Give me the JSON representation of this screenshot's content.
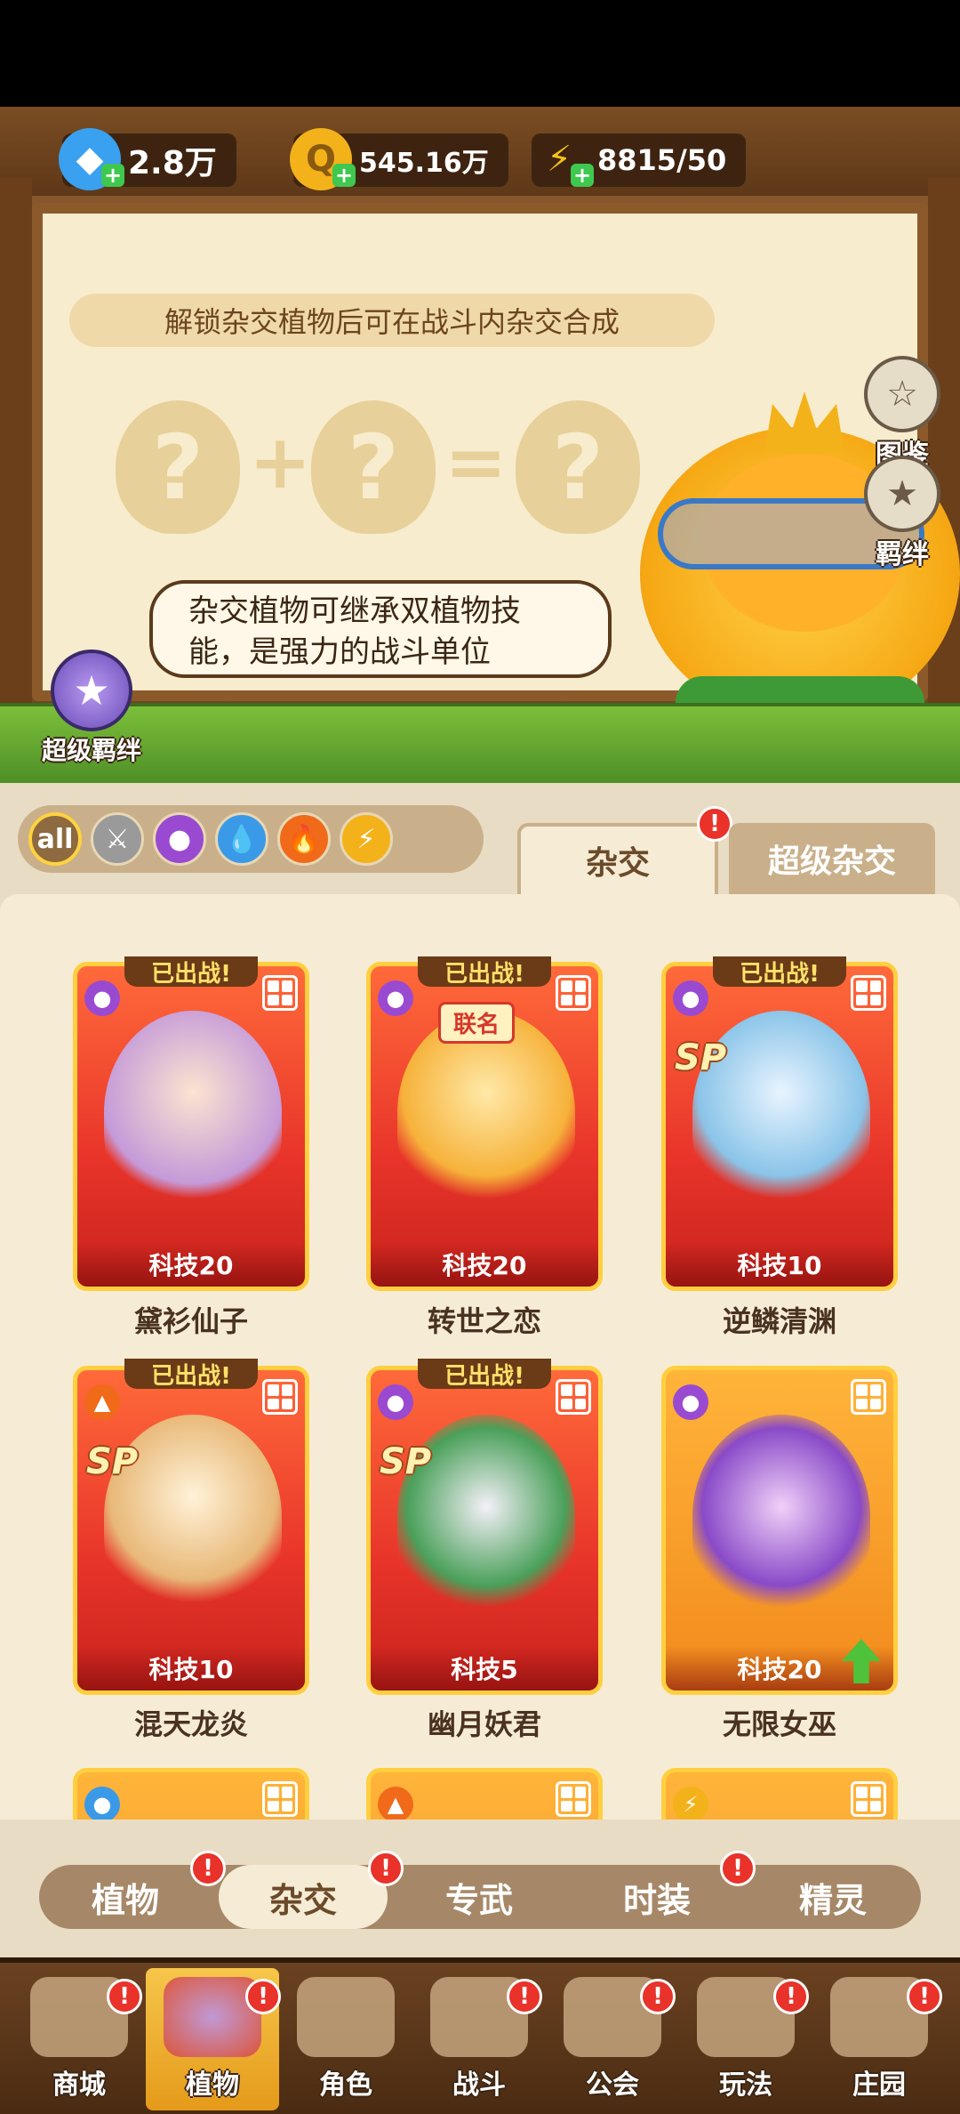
{
  "resources": [
    {
      "icon": "diamond-icon",
      "value": "2.8万"
    },
    {
      "icon": "coin-icon",
      "value": "545.16万"
    },
    {
      "icon": "energy-icon",
      "value": "8815/50"
    }
  ],
  "board": {
    "tip": "解锁杂交植物后可在战斗内杂交合成",
    "bubble": "杂交植物可继承双植物技能，是强力的战斗单位"
  },
  "side_buttons": {
    "codex": "图鉴",
    "bond": "羁绊",
    "super_bond": "超级羁绊"
  },
  "filters": [
    "all",
    "sword",
    "potion",
    "water",
    "fire",
    "lightning"
  ],
  "top_tabs": {
    "hybrid": "杂交",
    "super_hybrid": "超级杂交"
  },
  "deployed_label": "已出战!",
  "cards": [
    {
      "name": "黛衫仙子",
      "tech": "科技20",
      "deployed": true,
      "sp": false,
      "element": "potion"
    },
    {
      "name": "转世之恋",
      "tech": "科技20",
      "deployed": true,
      "sp": false,
      "element": "potion",
      "tag": "联名"
    },
    {
      "name": "逆鳞清渊",
      "tech": "科技10",
      "deployed": true,
      "sp": true,
      "element": "potion"
    },
    {
      "name": "混天龙炎",
      "tech": "科技10",
      "deployed": true,
      "sp": true,
      "element": "fire"
    },
    {
      "name": "幽月妖君",
      "tech": "科技5",
      "deployed": true,
      "sp": true,
      "element": "potion"
    },
    {
      "name": "无限女巫",
      "tech": "科技20",
      "deployed": false,
      "sp": false,
      "element": "potion",
      "upgrade": true
    }
  ],
  "sp_label": "SP",
  "sub_tabs": [
    "植物",
    "杂交",
    "专武",
    "时装",
    "精灵"
  ],
  "nav": [
    "商城",
    "植物",
    "角色",
    "战斗",
    "公会",
    "玩法",
    "庄园"
  ],
  "badge_text": "!"
}
